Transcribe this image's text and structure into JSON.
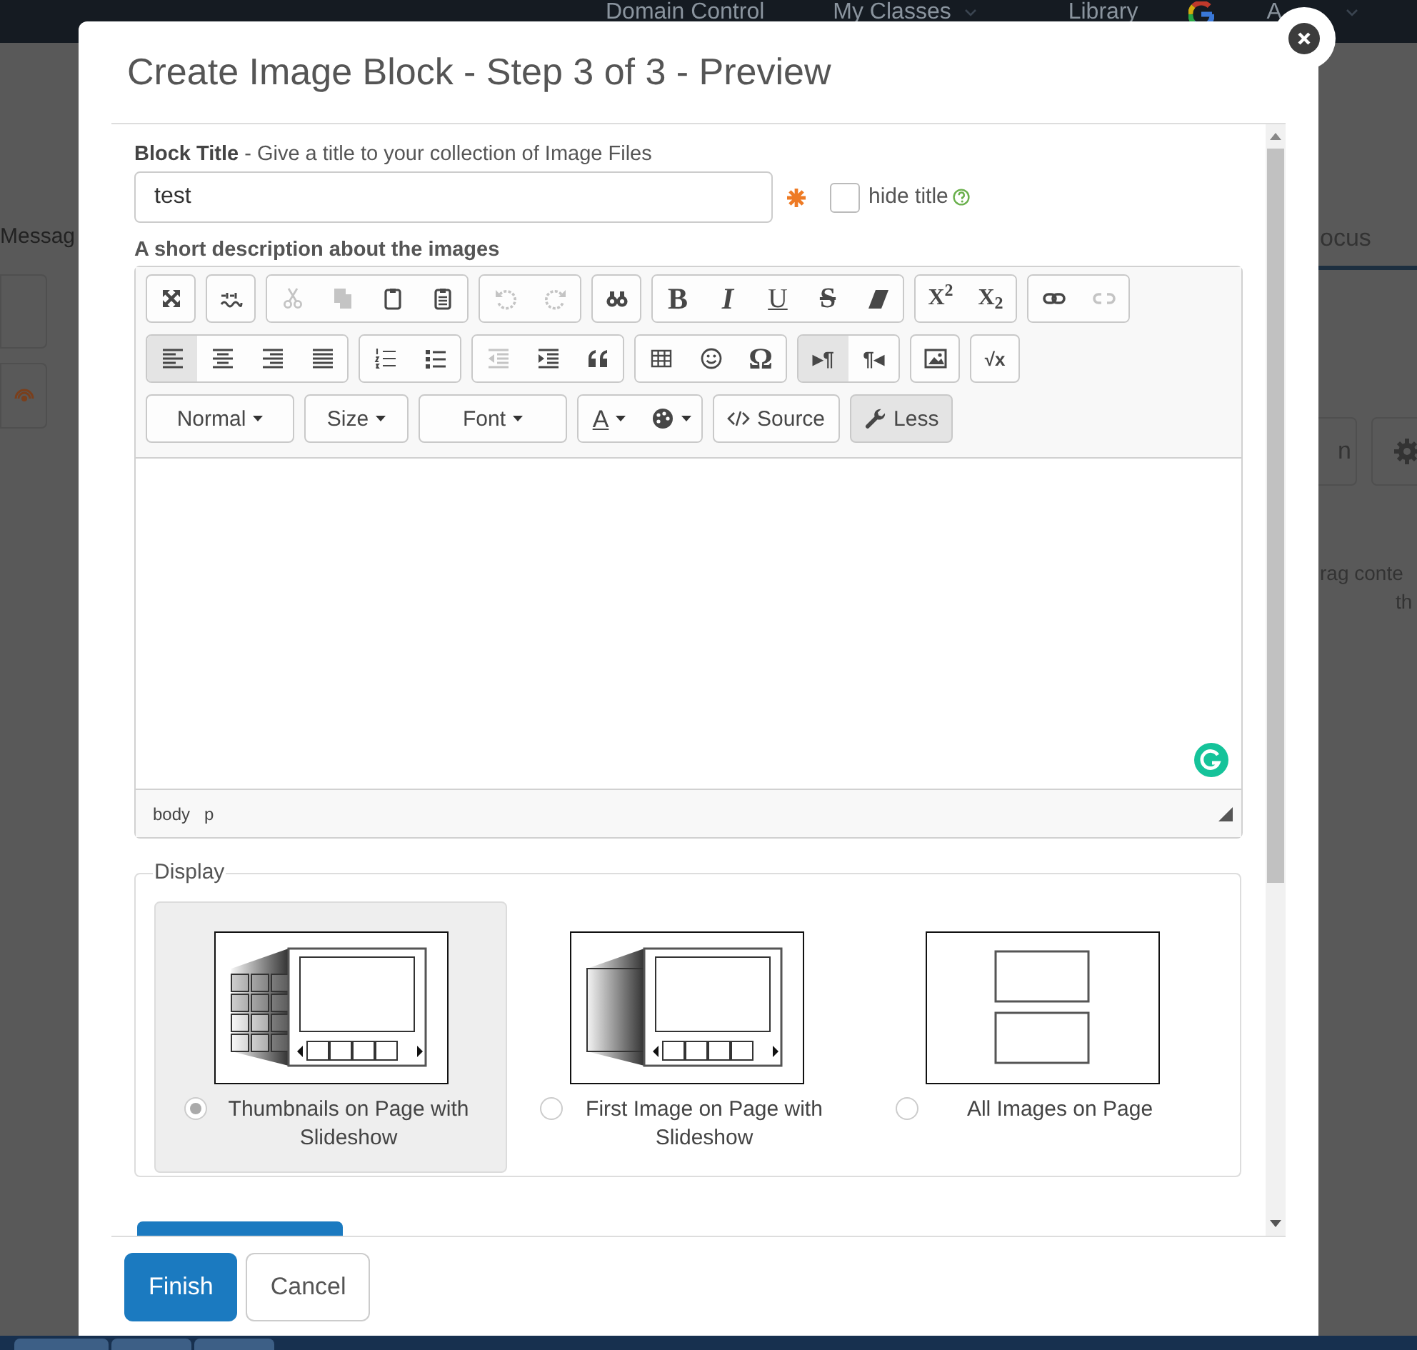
{
  "background_page": {
    "nav": [
      {
        "label": "Domain Control",
        "caret": false
      },
      {
        "label": "My Classes",
        "caret": true
      },
      {
        "label": "Library",
        "caret": false
      },
      {
        "label": "A",
        "caret": true
      }
    ],
    "left_tab": "Messag",
    "right_tab": "ocus",
    "side_button": "n",
    "side_text": [
      "rag conte",
      "th"
    ]
  },
  "dialog": {
    "title": "Create Image Block - Step 3 of 3 - Preview",
    "block_title": {
      "label": "Block Title",
      "hint": " - Give a title to your collection of Image Files",
      "value": "test",
      "required": true
    },
    "hide_title": {
      "label": "hide title",
      "checked": false
    },
    "description_label": "A short description about the images",
    "toolbar_rows": [
      {
        "groups": [
          {
            "buttons": [
              {
                "kind": "maximize",
                "disabled": false,
                "pressed": false
              }
            ]
          },
          {
            "buttons": [
              {
                "kind": "spellcheck",
                "disabled": false
              }
            ]
          },
          {
            "buttons": [
              {
                "kind": "cut",
                "disabled": true,
                "pressed": false
              },
              {
                "kind": "copy",
                "disabled": true,
                "pressed": false
              },
              {
                "kind": "paste",
                "disabled": false,
                "pressed": false
              },
              {
                "kind": "paste-text",
                "disabled": false,
                "pressed": false
              }
            ]
          },
          {
            "buttons": [
              {
                "kind": "undo",
                "disabled": true,
                "pressed": false
              },
              {
                "kind": "redo",
                "disabled": true,
                "pressed": false
              }
            ]
          },
          {
            "buttons": [
              {
                "kind": "find",
                "disabled": false,
                "pressed": false
              }
            ]
          },
          {
            "buttons": [
              {
                "kind": "bold",
                "label": "B",
                "disabled": false,
                "pressed": false
              },
              {
                "kind": "italic",
                "label": "I",
                "disabled": false,
                "pressed": false
              },
              {
                "kind": "underline",
                "label": "U",
                "disabled": false,
                "pressed": false
              },
              {
                "kind": "strike",
                "label": "S",
                "disabled": false,
                "pressed": false
              },
              {
                "kind": "eraser",
                "disabled": false,
                "pressed": false
              }
            ]
          },
          {
            "buttons": [
              {
                "kind": "superscript",
                "label": "X$^{2}$",
                "disabled": false,
                "pressed": false
              },
              {
                "kind": "subscript",
                "label": "X$_{2}$",
                "disabled": false,
                "pressed": false
              }
            ]
          },
          {
            "buttons": [
              {
                "kind": "link",
                "disabled": false,
                "pressed": false
              },
              {
                "kind": "unlink",
                "disabled": true,
                "pressed": false
              }
            ]
          }
        ]
      },
      {
        "groups": [
          {
            "buttons": [
              {
                "kind": "align-left",
                "disabled": false,
                "pressed": true
              },
              {
                "kind": "align-center",
                "disabled": false,
                "pressed": false
              },
              {
                "kind": "align-right",
                "disabled": false,
                "pressed": false
              },
              {
                "kind": "justify",
                "disabled": false,
                "pressed": false
              }
            ]
          },
          {
            "buttons": [
              {
                "kind": "numbered-list",
                "disabled": false,
                "pressed": false
              },
              {
                "kind": "bullet-list",
                "disabled": false,
                "pressed": false
              }
            ]
          },
          {
            "buttons": [
              {
                "kind": "outdent",
                "disabled": true,
                "pressed": false
              },
              {
                "kind": "indent",
                "disabled": false,
                "pressed": false
              },
              {
                "kind": "quote",
                "disabled": false,
                "pressed": false
              }
            ]
          },
          {
            "buttons": [
              {
                "kind": "table",
                "disabled": false,
                "pressed": false
              },
              {
                "kind": "smiley",
                "disabled": false,
                "pressed": false
              },
              {
                "kind": "omega",
                "label": "Ω",
                "disabled": false,
                "pressed": false
              }
            ]
          },
          {
            "buttons": [
              {
                "kind": "ltr",
                "label": "▸¶",
                "disabled": false,
                "pressed": true
              },
              {
                "kind": "rtl",
                "label": "¶◂",
                "disabled": false,
                "pressed": false
              }
            ]
          },
          {
            "buttons": [
              {
                "kind": "image",
                "disabled": false,
                "pressed": false
              }
            ]
          },
          {
            "buttons": [
              {
                "kind": "math",
                "label": "√x",
                "disabled": false,
                "pressed": false
              }
            ]
          }
        ]
      },
      {
        "groups": [
          {
            "buttons": [
              {
                "kind": "combo",
                "label": "Normal",
                "disabled": false,
                "pressed": false
              }
            ]
          },
          {
            "buttons": [
              {
                "kind": "combo",
                "label": "Size",
                "disabled": false,
                "pressed": false
              }
            ]
          },
          {
            "buttons": [
              {
                "kind": "combo",
                "label": "Font",
                "disabled": false,
                "pressed": false
              }
            ]
          },
          {
            "buttons": [
              {
                "kind": "text-color",
                "label": "A",
                "disabled": false,
                "pressed": false
              },
              {
                "kind": "bg-color",
                "disabled": false,
                "pressed": false
              }
            ]
          },
          {
            "buttons": [
              {
                "kind": "source",
                "label": "Source",
                "disabled": false,
                "pressed": false
              }
            ]
          },
          {
            "buttons": [
              {
                "kind": "less",
                "label": "Less",
                "disabled": false,
                "pressed": true
              }
            ]
          }
        ]
      }
    ],
    "path": [
      "body",
      "p"
    ],
    "display": {
      "legend": "Display",
      "options": [
        {
          "kind": "thumbnails",
          "label": "Thumbnails on Page with Slideshow",
          "selected": true
        },
        {
          "kind": "first-image",
          "label": "First Image on Page with Slideshow",
          "selected": false
        },
        {
          "kind": "all-images",
          "label": "All Images on Page",
          "selected": false
        }
      ]
    },
    "buttons": [
      {
        "kind": "primary",
        "label": "Finish"
      },
      {
        "kind": "default",
        "label": "Cancel"
      }
    ]
  }
}
